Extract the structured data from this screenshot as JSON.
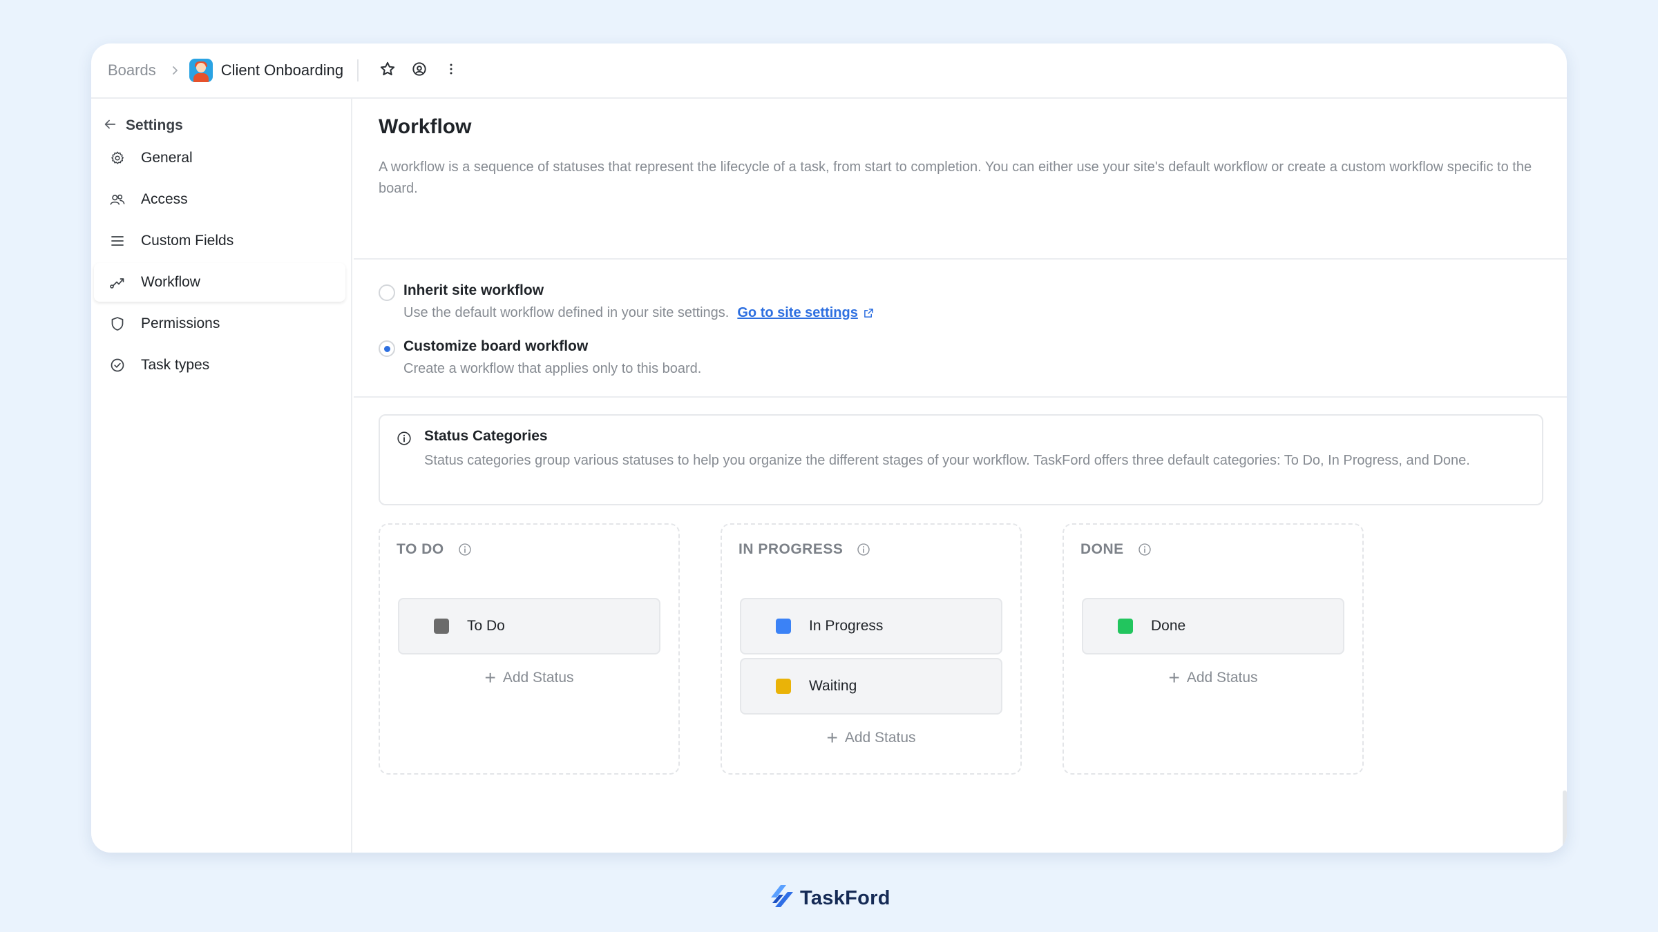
{
  "breadcrumb": {
    "root": "Boards",
    "board_name": "Client Onboarding"
  },
  "toolbar": {
    "icons": [
      "star-icon",
      "watch-icon",
      "more-vertical-icon"
    ]
  },
  "sidebar": {
    "back_label": "Settings",
    "items": [
      {
        "label": "General",
        "icon": "gear-icon"
      },
      {
        "label": "Access",
        "icon": "users-icon"
      },
      {
        "label": "Custom Fields",
        "icon": "list-icon"
      },
      {
        "label": "Workflow",
        "icon": "workflow-icon",
        "active": true
      },
      {
        "label": "Permissions",
        "icon": "shield-icon"
      },
      {
        "label": "Task types",
        "icon": "check-circle-icon"
      }
    ]
  },
  "main": {
    "title": "Workflow",
    "description": "A workflow is a sequence of statuses that represent the lifecycle of a task, from start to completion. You can either use your site's default workflow or create a custom workflow specific to the board.",
    "options": [
      {
        "title": "Inherit site workflow",
        "description": "Use the default workflow defined in your site settings.",
        "link": "Go to site settings",
        "selected": false
      },
      {
        "title": "Customize board workflow",
        "description": "Create a workflow that applies only to this board.",
        "selected": true
      }
    ],
    "info": {
      "title": "Status Categories",
      "description": "Status categories group various statuses to help you organize the different stages of your workflow. TaskFord offers three default categories: To Do, In Progress, and Done."
    },
    "columns": [
      {
        "label": "TO DO",
        "statuses": [
          {
            "name": "To Do",
            "color": "#6b6b6b"
          }
        ],
        "add_label": "Add Status"
      },
      {
        "label": "IN PROGRESS",
        "statuses": [
          {
            "name": "In Progress",
            "color": "#3b82f6"
          },
          {
            "name": "Waiting",
            "color": "#eab308"
          }
        ],
        "add_label": "Add Status"
      },
      {
        "label": "DONE",
        "statuses": [
          {
            "name": "Done",
            "color": "#22c55e"
          }
        ],
        "add_label": "Add Status"
      }
    ]
  },
  "footer": {
    "brand": "TaskFord",
    "brand_color": "#2f6ee6"
  }
}
